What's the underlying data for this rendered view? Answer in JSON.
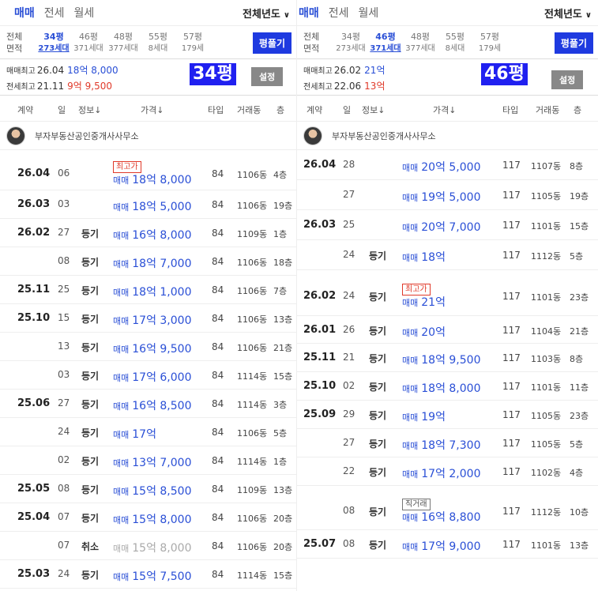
{
  "panels": [
    {
      "id": "left",
      "tabs": [
        "매매",
        "전세",
        "월세"
      ],
      "active_tab": 0,
      "year_filter": "전체년도",
      "area": {
        "label_line1": "전체",
        "label_line2": "면적",
        "options": [
          {
            "pyeong": "34평",
            "units": "273세대",
            "selected": true
          },
          {
            "pyeong": "46평",
            "units": "371세대",
            "selected": false
          },
          {
            "pyeong": "48평",
            "units": "377세대",
            "selected": false
          },
          {
            "pyeong": "55평",
            "units": "8세대",
            "selected": false
          },
          {
            "pyeong": "57평",
            "units": "179세",
            "selected": false
          }
        ],
        "button": "평풀기"
      },
      "summary": {
        "sale_label": "매매최고",
        "sale_date": "26.04",
        "sale_price": "18억 8,000",
        "jeonse_label": "전세최고",
        "jeonse_date": "21.11",
        "jeonse_price": "9억 9,500",
        "big_pyeong": "34평",
        "settings": "설정"
      },
      "headers": [
        "계약",
        "일",
        "정보↓",
        "가격↓",
        "타입",
        "거래동",
        "층"
      ],
      "realtor": "부자부동산공인중개사사무소",
      "rows": [
        {
          "ym": "26.04",
          "day": "06",
          "info": "",
          "badge": "최고가",
          "badge_style": "red",
          "type_label": "매매",
          "price": "18억 8,000",
          "area": "84",
          "building": "1106동",
          "floor": "4층",
          "h": 51
        },
        {
          "ym": "26.03",
          "day": "03",
          "info": "",
          "type_label": "매매",
          "price": "18억 5,000",
          "area": "84",
          "building": "1106동",
          "floor": "19층",
          "h": 36
        },
        {
          "ym": "26.02",
          "day": "27",
          "info": "등기",
          "type_label": "매매",
          "price": "16억 8,000",
          "area": "84",
          "building": "1109동",
          "floor": "1층",
          "h": 36
        },
        {
          "ym": "",
          "day": "08",
          "info": "등기",
          "type_label": "매매",
          "price": "18억 7,000",
          "area": "84",
          "building": "1106동",
          "floor": "18층",
          "h": 36
        },
        {
          "ym": "25.11",
          "day": "25",
          "info": "등기",
          "type_label": "매매",
          "price": "18억 1,000",
          "area": "84",
          "building": "1106동",
          "floor": "7층",
          "h": 36
        },
        {
          "ym": "25.10",
          "day": "15",
          "info": "등기",
          "type_label": "매매",
          "price": "17억 3,000",
          "area": "84",
          "building": "1106동",
          "floor": "13층",
          "h": 36
        },
        {
          "ym": "",
          "day": "13",
          "info": "등기",
          "type_label": "매매",
          "price": "16억 9,500",
          "area": "84",
          "building": "1106동",
          "floor": "21층",
          "h": 36
        },
        {
          "ym": "",
          "day": "03",
          "info": "등기",
          "type_label": "매매",
          "price": "17억 6,000",
          "area": "84",
          "building": "1114동",
          "floor": "15층",
          "h": 36
        },
        {
          "ym": "25.06",
          "day": "27",
          "info": "등기",
          "type_label": "매매",
          "price": "16억 8,500",
          "area": "84",
          "building": "1114동",
          "floor": "3층",
          "h": 36
        },
        {
          "ym": "",
          "day": "24",
          "info": "등기",
          "type_label": "매매",
          "price": "17억",
          "area": "84",
          "building": "1106동",
          "floor": "5층",
          "h": 36
        },
        {
          "ym": "",
          "day": "02",
          "info": "등기",
          "type_label": "매매",
          "price": "13억 7,000",
          "area": "84",
          "building": "1114동",
          "floor": "1층",
          "h": 36
        },
        {
          "ym": "25.05",
          "day": "08",
          "info": "등기",
          "type_label": "매매",
          "price": "15억 8,500",
          "area": "84",
          "building": "1109동",
          "floor": "13층",
          "h": 36
        },
        {
          "ym": "25.04",
          "day": "07",
          "info": "등기",
          "type_label": "매매",
          "price": "15억 8,000",
          "area": "84",
          "building": "1106동",
          "floor": "20층",
          "h": 36
        },
        {
          "ym": "",
          "day": "07",
          "info": "취소",
          "type_label": "매매",
          "price": "15억 8,000",
          "area": "84",
          "building": "1106동",
          "floor": "20층",
          "h": 36,
          "cancelled": true
        },
        {
          "ym": "25.03",
          "day": "24",
          "info": "등기",
          "type_label": "매매",
          "price": "15억 7,500",
          "area": "84",
          "building": "1114동",
          "floor": "15층",
          "h": 36
        }
      ]
    },
    {
      "id": "right",
      "tabs": [
        "매매",
        "전세",
        "월세"
      ],
      "active_tab": 0,
      "year_filter": "전체년도",
      "area": {
        "label_line1": "전체",
        "label_line2": "면적",
        "options": [
          {
            "pyeong": "34평",
            "units": "273세대",
            "selected": false
          },
          {
            "pyeong": "46평",
            "units": "371세대",
            "selected": true
          },
          {
            "pyeong": "48평",
            "units": "377세대",
            "selected": false
          },
          {
            "pyeong": "55평",
            "units": "8세대",
            "selected": false
          },
          {
            "pyeong": "57평",
            "units": "179세",
            "selected": false
          }
        ],
        "button": "평풀기"
      },
      "summary": {
        "sale_label": "매매최고",
        "sale_date": "26.02",
        "sale_price": "21억",
        "jeonse_label": "전세최고",
        "jeonse_date": "22.06",
        "jeonse_price": "13억",
        "big_pyeong": "46평",
        "settings": "설정"
      },
      "headers": [
        "계약",
        "일",
        "정보↓",
        "가격↓",
        "타입",
        "거래동",
        "층"
      ],
      "realtor": "부자부동산공인중개사사무소",
      "rows": [
        {
          "ym": "26.04",
          "day": "28",
          "info": "",
          "type_label": "매매",
          "price": "20억 5,000",
          "area": "117",
          "building": "1107동",
          "floor": "8층",
          "h": 38
        },
        {
          "ym": "",
          "day": "27",
          "info": "",
          "type_label": "매매",
          "price": "19억 5,000",
          "area": "117",
          "building": "1105동",
          "floor": "19층",
          "h": 38
        },
        {
          "ym": "26.03",
          "day": "25",
          "info": "",
          "type_label": "매매",
          "price": "20억 7,000",
          "area": "117",
          "building": "1101동",
          "floor": "15층",
          "h": 38
        },
        {
          "ym": "",
          "day": "24",
          "info": "등기",
          "type_label": "매매",
          "price": "18억",
          "area": "117",
          "building": "1112동",
          "floor": "5층",
          "h": 38
        },
        {
          "ym": "26.02",
          "day": "24",
          "info": "등기",
          "badge": "최고가",
          "badge_style": "red",
          "type_label": "매매",
          "price": "21억",
          "area": "117",
          "building": "1101동",
          "floor": "23층",
          "h": 58
        },
        {
          "ym": "26.01",
          "day": "26",
          "info": "등기",
          "type_label": "매매",
          "price": "20억",
          "area": "117",
          "building": "1104동",
          "floor": "21층",
          "h": 35
        },
        {
          "ym": "25.11",
          "day": "21",
          "info": "등기",
          "type_label": "매매",
          "price": "18억 9,500",
          "area": "117",
          "building": "1103동",
          "floor": "8층",
          "h": 36
        },
        {
          "ym": "25.10",
          "day": "02",
          "info": "등기",
          "type_label": "매매",
          "price": "18억 8,000",
          "area": "117",
          "building": "1101동",
          "floor": "11층",
          "h": 36
        },
        {
          "ym": "25.09",
          "day": "29",
          "info": "등기",
          "type_label": "매매",
          "price": "19억",
          "area": "117",
          "building": "1105동",
          "floor": "23층",
          "h": 36
        },
        {
          "ym": "",
          "day": "27",
          "info": "등기",
          "type_label": "매매",
          "price": "18억 7,300",
          "area": "117",
          "building": "1105동",
          "floor": "5층",
          "h": 36
        },
        {
          "ym": "",
          "day": "22",
          "info": "등기",
          "type_label": "매매",
          "price": "17억 2,000",
          "area": "117",
          "building": "1102동",
          "floor": "4층",
          "h": 36
        },
        {
          "ym": "",
          "day": "08",
          "info": "등기",
          "badge": "직거래",
          "badge_style": "gray",
          "type_label": "매매",
          "price": "16억 8,800",
          "area": "117",
          "building": "1112동",
          "floor": "10층",
          "h": 56
        },
        {
          "ym": "25.07",
          "day": "08",
          "info": "등기",
          "type_label": "매매",
          "price": "17억 9,000",
          "area": "117",
          "building": "1101동",
          "floor": "13층",
          "h": 36
        }
      ]
    }
  ]
}
